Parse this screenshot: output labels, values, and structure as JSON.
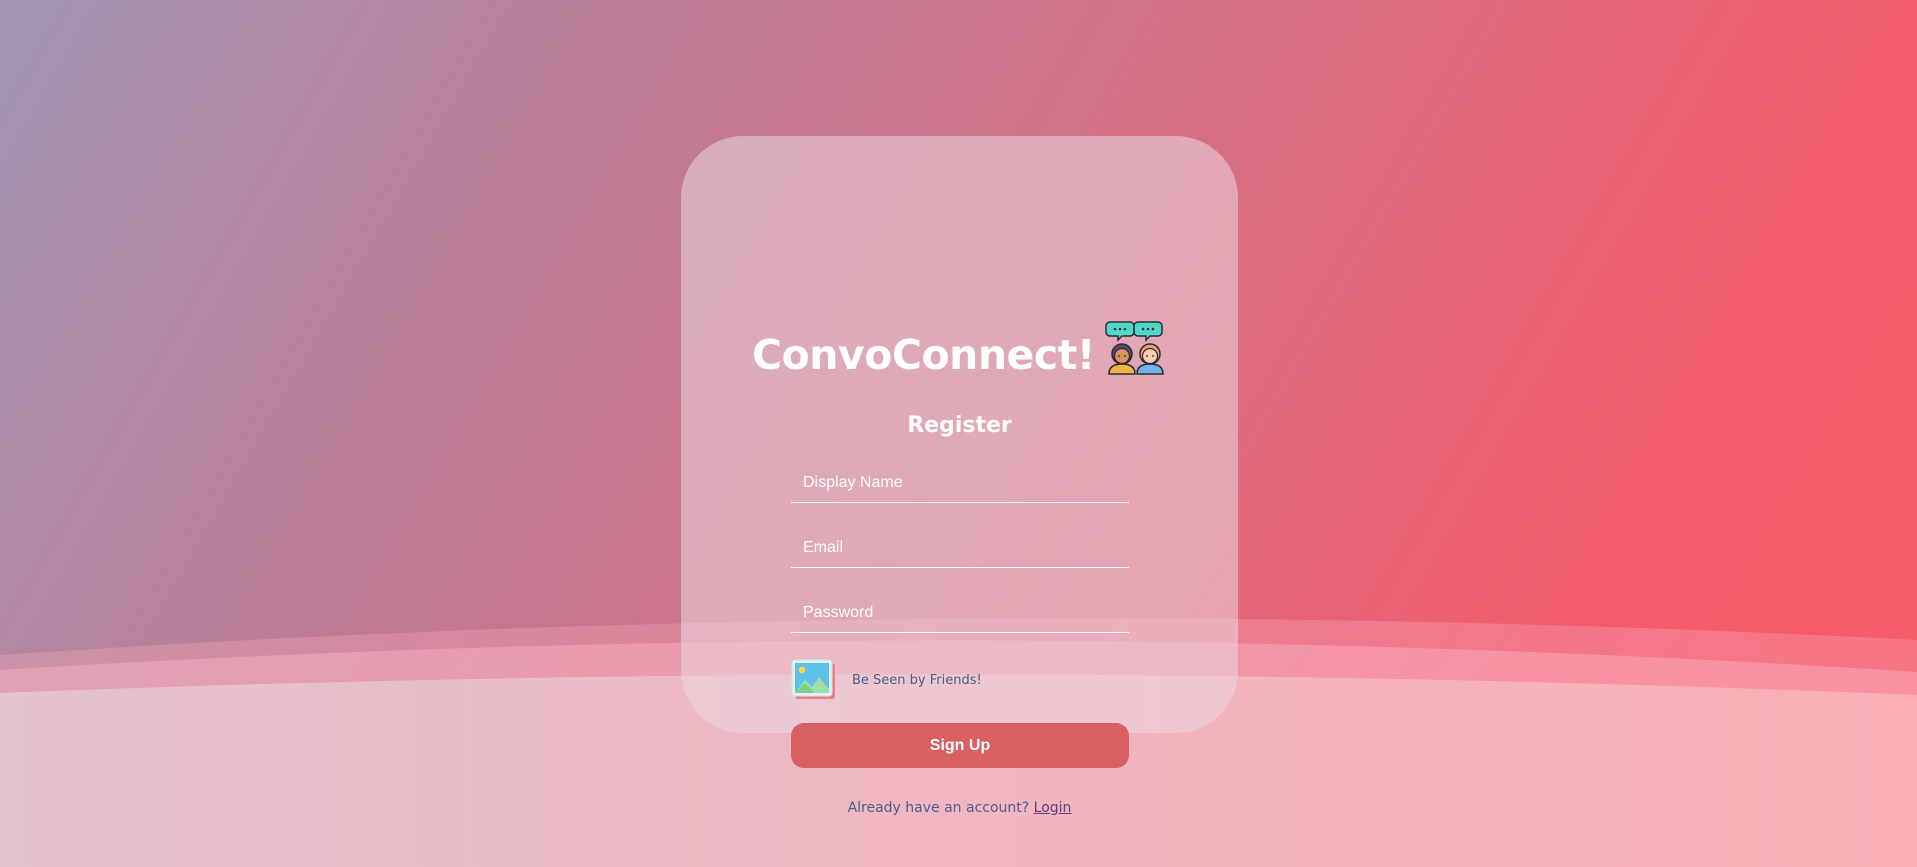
{
  "app": {
    "title": "ConvoConnect!",
    "logo_icon": "two-people-chat-bubbles-icon"
  },
  "form": {
    "heading": "Register",
    "display_name": {
      "value": "",
      "placeholder": "Display Name"
    },
    "email": {
      "value": "",
      "placeholder": "Email"
    },
    "password": {
      "value": "",
      "placeholder": "Password"
    },
    "avatar": {
      "icon": "image-picture-icon",
      "label": "Be Seen by Friends!"
    },
    "submit_label": "Sign Up"
  },
  "footer": {
    "prompt": "Already have an account?",
    "link_label": "Login"
  },
  "colors": {
    "button": "#d86062",
    "accent_text": "#4a5d8c",
    "link": "#5a3f86"
  }
}
